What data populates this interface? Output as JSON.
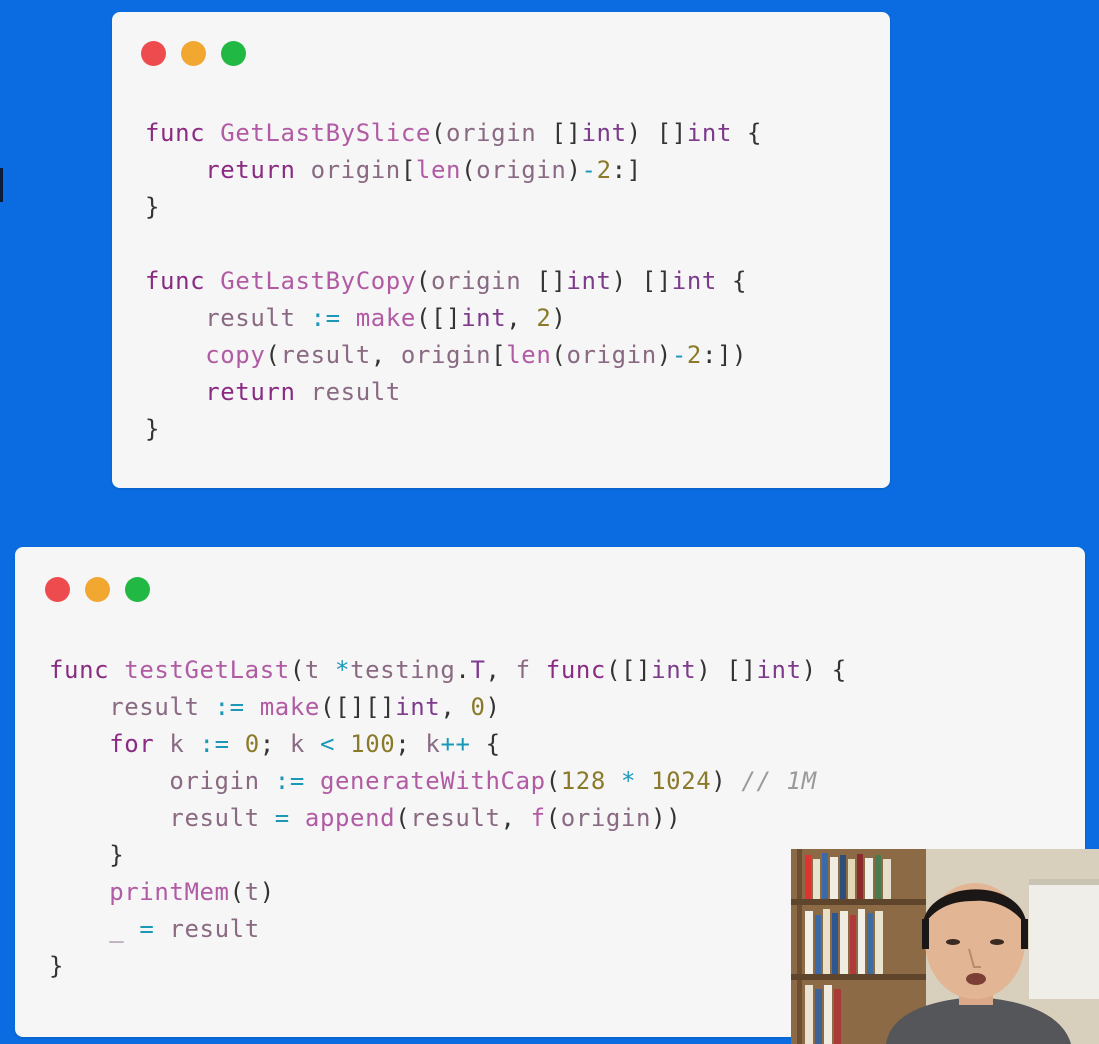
{
  "window_top": {
    "code_lines": [
      [
        [
          "kw",
          "func"
        ],
        [
          "pn",
          " "
        ],
        [
          "fn",
          "GetLastBySlice"
        ],
        [
          "pn",
          "("
        ],
        [
          "id",
          "origin"
        ],
        [
          "pn",
          " []"
        ],
        [
          "tp",
          "int"
        ],
        [
          "pn",
          ") []"
        ],
        [
          "tp",
          "int"
        ],
        [
          "pn",
          " {"
        ]
      ],
      [
        [
          "pn",
          "    "
        ],
        [
          "kw",
          "return"
        ],
        [
          "pn",
          " "
        ],
        [
          "id",
          "origin"
        ],
        [
          "pn",
          "["
        ],
        [
          "fn",
          "len"
        ],
        [
          "pn",
          "("
        ],
        [
          "id",
          "origin"
        ],
        [
          "pn",
          ")"
        ],
        [
          "op",
          "-"
        ],
        [
          "num",
          "2"
        ],
        [
          "pn",
          ":]"
        ]
      ],
      [
        [
          "pn",
          "}"
        ]
      ],
      [],
      [
        [
          "kw",
          "func"
        ],
        [
          "pn",
          " "
        ],
        [
          "fn",
          "GetLastByCopy"
        ],
        [
          "pn",
          "("
        ],
        [
          "id",
          "origin"
        ],
        [
          "pn",
          " []"
        ],
        [
          "tp",
          "int"
        ],
        [
          "pn",
          ") []"
        ],
        [
          "tp",
          "int"
        ],
        [
          "pn",
          " {"
        ]
      ],
      [
        [
          "pn",
          "    "
        ],
        [
          "id",
          "result"
        ],
        [
          "pn",
          " "
        ],
        [
          "op",
          ":="
        ],
        [
          "pn",
          " "
        ],
        [
          "fn",
          "make"
        ],
        [
          "pn",
          "([]"
        ],
        [
          "tp",
          "int"
        ],
        [
          "pn",
          ", "
        ],
        [
          "num",
          "2"
        ],
        [
          "pn",
          ")"
        ]
      ],
      [
        [
          "pn",
          "    "
        ],
        [
          "fn",
          "copy"
        ],
        [
          "pn",
          "("
        ],
        [
          "id",
          "result"
        ],
        [
          "pn",
          ", "
        ],
        [
          "id",
          "origin"
        ],
        [
          "pn",
          "["
        ],
        [
          "fn",
          "len"
        ],
        [
          "pn",
          "("
        ],
        [
          "id",
          "origin"
        ],
        [
          "pn",
          ")"
        ],
        [
          "op",
          "-"
        ],
        [
          "num",
          "2"
        ],
        [
          "pn",
          ":])"
        ]
      ],
      [
        [
          "pn",
          "    "
        ],
        [
          "kw",
          "return"
        ],
        [
          "pn",
          " "
        ],
        [
          "id",
          "result"
        ]
      ],
      [
        [
          "pn",
          "}"
        ]
      ]
    ]
  },
  "window_bottom": {
    "code_lines": [
      [
        [
          "kw",
          "func"
        ],
        [
          "pn",
          " "
        ],
        [
          "fn",
          "testGetLast"
        ],
        [
          "pn",
          "("
        ],
        [
          "id",
          "t"
        ],
        [
          "pn",
          " "
        ],
        [
          "op",
          "*"
        ],
        [
          "id",
          "testing"
        ],
        [
          "pn",
          "."
        ],
        [
          "tp",
          "T"
        ],
        [
          "pn",
          ", "
        ],
        [
          "id",
          "f"
        ],
        [
          "pn",
          " "
        ],
        [
          "kw",
          "func"
        ],
        [
          "pn",
          "([]"
        ],
        [
          "tp",
          "int"
        ],
        [
          "pn",
          ") []"
        ],
        [
          "tp",
          "int"
        ],
        [
          "pn",
          ") {"
        ]
      ],
      [
        [
          "pn",
          "    "
        ],
        [
          "id",
          "result"
        ],
        [
          "pn",
          " "
        ],
        [
          "op",
          ":="
        ],
        [
          "pn",
          " "
        ],
        [
          "fn",
          "make"
        ],
        [
          "pn",
          "([][]"
        ],
        [
          "tp",
          "int"
        ],
        [
          "pn",
          ", "
        ],
        [
          "num",
          "0"
        ],
        [
          "pn",
          ")"
        ]
      ],
      [
        [
          "pn",
          "    "
        ],
        [
          "kw",
          "for"
        ],
        [
          "pn",
          " "
        ],
        [
          "id",
          "k"
        ],
        [
          "pn",
          " "
        ],
        [
          "op",
          ":="
        ],
        [
          "pn",
          " "
        ],
        [
          "num",
          "0"
        ],
        [
          "pn",
          "; "
        ],
        [
          "id",
          "k"
        ],
        [
          "pn",
          " "
        ],
        [
          "op",
          "<"
        ],
        [
          "pn",
          " "
        ],
        [
          "num",
          "100"
        ],
        [
          "pn",
          "; "
        ],
        [
          "id",
          "k"
        ],
        [
          "op",
          "++"
        ],
        [
          "pn",
          " {"
        ]
      ],
      [
        [
          "pn",
          "        "
        ],
        [
          "id",
          "origin"
        ],
        [
          "pn",
          " "
        ],
        [
          "op",
          ":="
        ],
        [
          "pn",
          " "
        ],
        [
          "fn",
          "generateWithCap"
        ],
        [
          "pn",
          "("
        ],
        [
          "num",
          "128"
        ],
        [
          "pn",
          " "
        ],
        [
          "op",
          "*"
        ],
        [
          "pn",
          " "
        ],
        [
          "num",
          "1024"
        ],
        [
          "pn",
          ") "
        ],
        [
          "cm",
          "// 1M"
        ]
      ],
      [
        [
          "pn",
          "        "
        ],
        [
          "id",
          "result"
        ],
        [
          "pn",
          " "
        ],
        [
          "op",
          "="
        ],
        [
          "pn",
          " "
        ],
        [
          "fn",
          "append"
        ],
        [
          "pn",
          "("
        ],
        [
          "id",
          "result"
        ],
        [
          "pn",
          ", "
        ],
        [
          "fn",
          "f"
        ],
        [
          "pn",
          "("
        ],
        [
          "id",
          "origin"
        ],
        [
          "pn",
          "))"
        ]
      ],
      [
        [
          "pn",
          "    }"
        ]
      ],
      [
        [
          "pn",
          "    "
        ],
        [
          "fn",
          "printMem"
        ],
        [
          "pn",
          "("
        ],
        [
          "id",
          "t"
        ],
        [
          "pn",
          ")"
        ]
      ],
      [
        [
          "pn",
          "    "
        ],
        [
          "id",
          "_"
        ],
        [
          "pn",
          " "
        ],
        [
          "op",
          "="
        ],
        [
          "pn",
          " "
        ],
        [
          "id",
          "result"
        ]
      ],
      [
        [
          "pn",
          "}"
        ]
      ]
    ]
  },
  "colors": {
    "background": "#0a6ce0",
    "window_bg": "#f6f6f6",
    "dot_red": "#ee4b4f",
    "dot_yellow": "#f2a730",
    "dot_green": "#21b944"
  }
}
